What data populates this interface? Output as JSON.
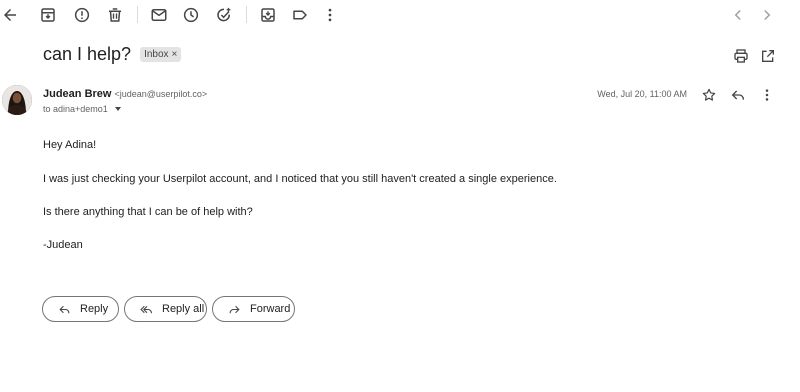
{
  "toolbar": {
    "icons": [
      "back-arrow-icon",
      "archive-icon",
      "report-spam-icon",
      "delete-icon",
      "mark-unread-icon",
      "snooze-icon",
      "add-to-tasks-icon",
      "move-to-icon",
      "label-icon",
      "more-vert-icon",
      "older-chevron-left-icon",
      "newer-chevron-right-icon"
    ]
  },
  "email": {
    "subject": "can I help?",
    "label": "Inbox",
    "label_remove": "×",
    "sender_name": "Judean Brew",
    "sender_email": "<judean@userpilot.co>",
    "to_line": "to adina+demo1",
    "date": "Wed, Jul 20, 11:00 AM",
    "body": {
      "greeting": "Hey Adina!",
      "line1": "I was just checking your Userpilot account, and I noticed that you still haven't created a single experience.",
      "line2": "Is there anything that I can be of help with?",
      "signature": "-Judean"
    }
  },
  "actions": {
    "reply": "Reply",
    "reply_all": "Reply all",
    "forward": "Forward"
  },
  "colors": {
    "icon": "#444746",
    "text": "#202124",
    "muted": "#5f6368",
    "chip_bg": "#e3e3e3",
    "button_border": "#747775"
  }
}
